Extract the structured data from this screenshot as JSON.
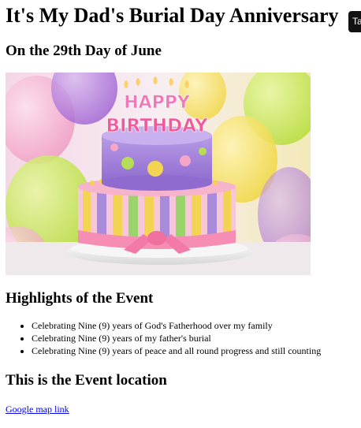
{
  "page": {
    "title": "It's My Dad's Burial Day Anniversary",
    "subtitle": "On the 29th Day of June",
    "corner_tab_label": "Ta"
  },
  "hero_image": {
    "alt": "Birthday cake",
    "cake_text_top": "HAPPY",
    "cake_text_bottom": "BIRTHDAY"
  },
  "highlights": {
    "heading": "Highlights of the Event",
    "items": [
      "Celebrating Nine (9) years of God's Fatherhood over my family",
      "Celebrating Nine (9) years of my father's burial",
      "Celebrating Nine (9) years of peace and all round progress and still counting"
    ]
  },
  "location": {
    "heading": "This is the Event location",
    "link_text": "Google map link"
  }
}
